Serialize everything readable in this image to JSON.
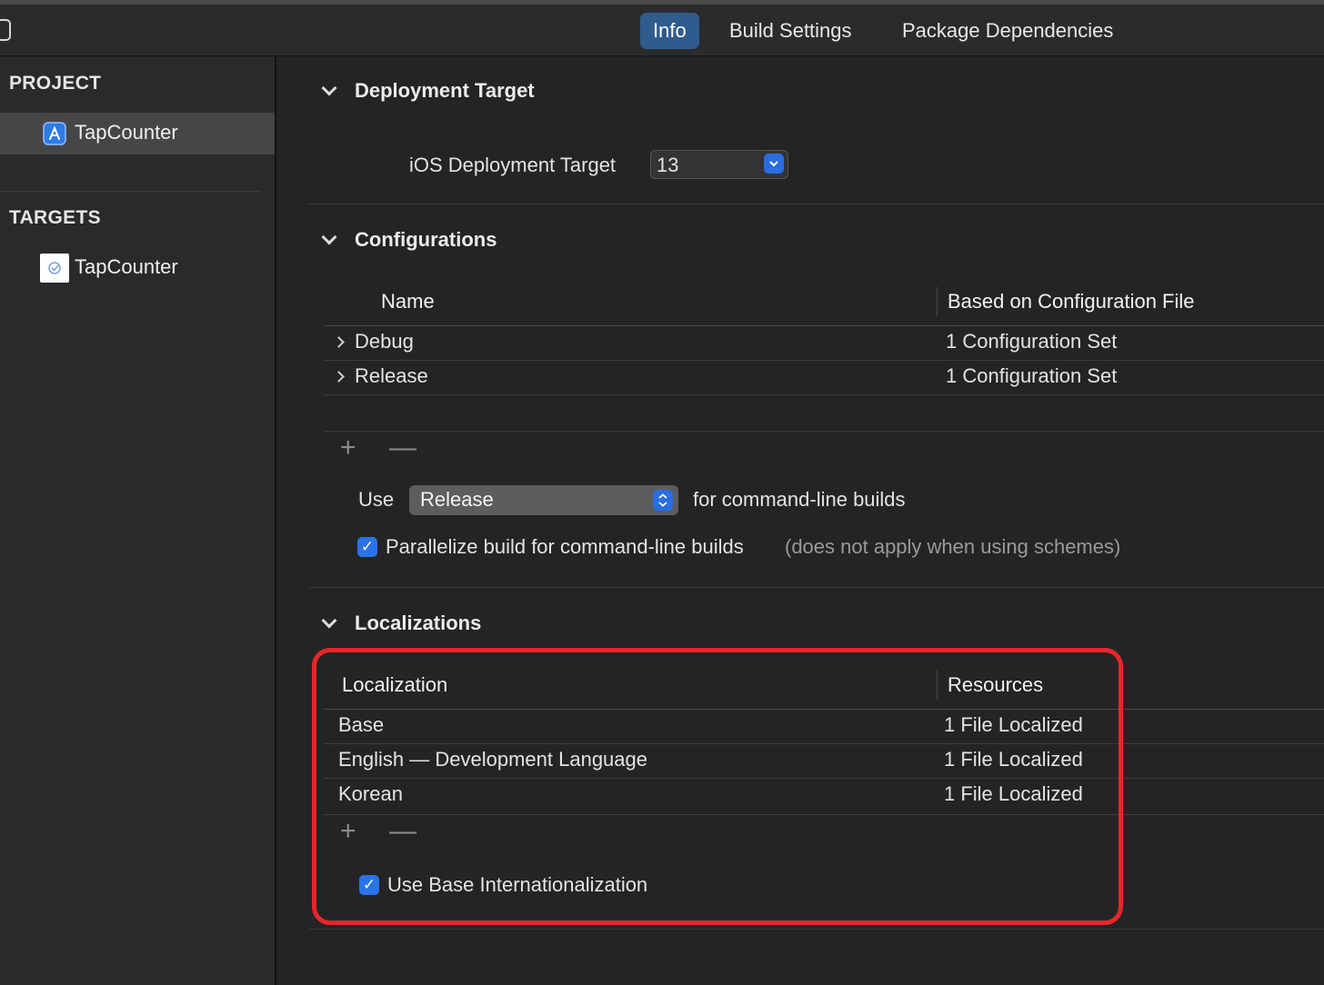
{
  "tabs": [
    "Info",
    "Build Settings",
    "Package Dependencies"
  ],
  "sidebar": {
    "project_heading": "PROJECT",
    "project_item": "TapCounter",
    "targets_heading": "TARGETS",
    "target_item": "TapCounter"
  },
  "deployment": {
    "title": "Deployment Target",
    "label": "iOS Deployment Target",
    "value": "13"
  },
  "configurations": {
    "title": "Configurations",
    "col_name": "Name",
    "col_file": "Based on Configuration File",
    "rows": [
      {
        "name": "Debug",
        "file": "1 Configuration Set"
      },
      {
        "name": "Release",
        "file": "1 Configuration Set"
      }
    ],
    "use_label": "Use",
    "use_value": "Release",
    "use_suffix": "for command-line builds",
    "parallelize_label": "Parallelize build for command-line builds",
    "parallelize_note": "(does not apply when using schemes)",
    "parallelize_checked": true
  },
  "localizations": {
    "title": "Localizations",
    "col_loc": "Localization",
    "col_res": "Resources",
    "rows": [
      {
        "name": "Base",
        "res": "1 File Localized"
      },
      {
        "name": "English — Development Language",
        "res": "1 File Localized"
      },
      {
        "name": "Korean",
        "res": "1 File Localized"
      }
    ],
    "base_intl_label": "Use Base Internationalization",
    "base_intl_checked": true
  },
  "controls": {
    "plus": "+",
    "minus": "—",
    "check": "✓"
  },
  "colors": {
    "accent": "#2a74e8",
    "selected_tab": "#2f5c8c",
    "highlight": "#e8262a"
  }
}
